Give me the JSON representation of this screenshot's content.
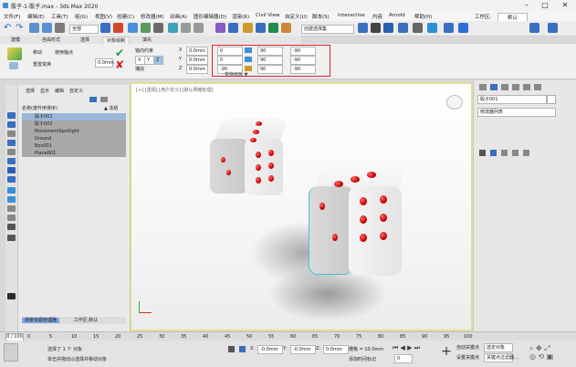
{
  "titlebar": {
    "title": "骰子-1-骰子.max - 3ds Max 2020",
    "minimize": "–",
    "maximize": "□",
    "close": "✕"
  },
  "menubar": {
    "items": [
      "文件(F)",
      "编辑(E)",
      "工具(T)",
      "组(G)",
      "视图(V)",
      "创建(C)",
      "修改器(M)",
      "动画(A)",
      "图形编辑器(D)",
      "渲染(R)",
      "Civil View",
      "自定义(U)",
      "脚本(S)",
      "Interactive",
      "内容",
      "Arnold",
      "帮助(H)"
    ],
    "workspace_label": "工作区:",
    "workspace_value": "默认"
  },
  "toolbar": {
    "selection_filter": "全部",
    "selection_set": "创建选择集"
  },
  "ribbon_tabs": [
    "建模",
    "自由形式",
    "选择",
    "对象绘制",
    "填充"
  ],
  "ribbon": {
    "group1_label": "移动",
    "group2_label": "轴向约束",
    "group3_label": "捕捉",
    "group4_label": "偏移",
    "group5_label": "重置变换",
    "pivot_label": "使用轴点",
    "x_label": "X",
    "y_label": "Y",
    "z_label": "Z",
    "unit_x": "0.0mm",
    "unit_y": "0.0mm",
    "unit_z": "0.0mm",
    "rx": "0",
    "ry": "0",
    "rz": "-90",
    "sx": "90",
    "sy": "90",
    "sz": "90",
    "vx": "-90",
    "vy": "-90",
    "vz": "-90",
    "footer": "变换面板 ▼"
  },
  "scene_explorer": {
    "tabs": [
      "选择",
      "显示",
      "编辑",
      "自定义"
    ],
    "header_name": "名称(按升序排序)",
    "header_frozen": "▲ 冻结",
    "rows": [
      "骰子001",
      "骰子002",
      "MovementSpotlight",
      "Ground",
      "Box001",
      "Plane001"
    ],
    "footer_left": "场景资源管理器",
    "footer_right": "工作区:默认"
  },
  "viewport": {
    "label": "[+] [透视] [用户定义] [默认明暗处理]"
  },
  "rightpanel": {
    "object_name": "骰子001",
    "modifier_list": "修改器列表"
  },
  "timeline": {
    "frame": "0 / 100",
    "ticks": [
      "0",
      "5",
      "10",
      "15",
      "20",
      "25",
      "30",
      "35",
      "40",
      "45",
      "50",
      "55",
      "60",
      "65",
      "70",
      "75",
      "80",
      "85",
      "90",
      "95",
      "100"
    ]
  },
  "status": {
    "selection": "选择了 1 个 对象",
    "prompt": "单击并拖动以选择并移动对象",
    "x_label": "X:",
    "x_val": "-0.0mm",
    "y_label": "Y:",
    "y_val": "-0.0mm",
    "z_label": "Z:",
    "z_val": "0.0mm",
    "grid": "栅格 = 10.0mm",
    "addtime": "添加时间标记",
    "autokey": "自动关键点",
    "setkey": "设置关键点",
    "filter": "关键点过滤器...",
    "selected": "选定对象",
    "frame_field": "0"
  },
  "colors": {
    "highlight": "#e02020",
    "viewport_border": "#f0e05a",
    "accent": "#2b6cd6"
  }
}
